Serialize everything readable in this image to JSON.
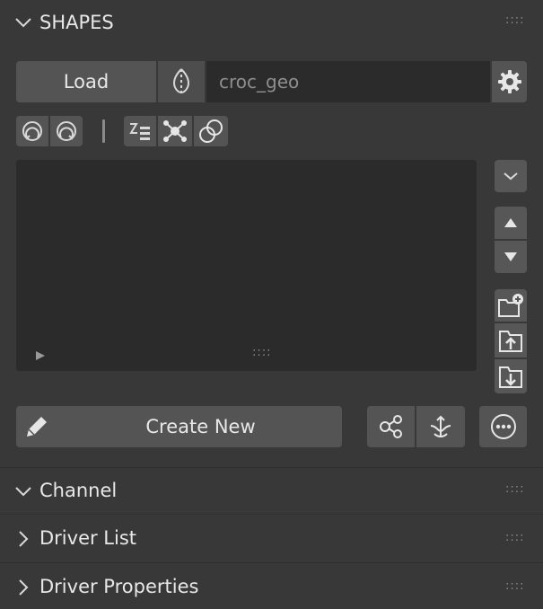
{
  "shapes_panel": {
    "title": "SHAPES",
    "load_label": "Load",
    "geo_name": "croc_geo",
    "create_new_label": "Create New"
  },
  "sub_panels": {
    "channel": "Channel",
    "driver_list": "Driver List",
    "driver_properties": "Driver Properties"
  },
  "icons": {
    "collapse": "chevron-down-icon",
    "expand": "chevron-right-icon",
    "gear": "gear-icon",
    "mirror": "mirror-icon",
    "pencil": "pencil-icon",
    "more": "ellipsis-circle-icon"
  }
}
